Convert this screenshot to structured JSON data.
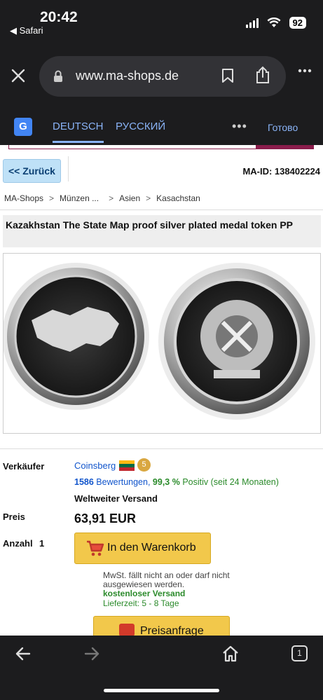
{
  "status": {
    "time": "20:42",
    "back_app": "◀ Safari",
    "battery": "92"
  },
  "browser": {
    "url": "www.ma-shops.de"
  },
  "translate": {
    "tabs": [
      "DEUTSCH",
      "РУССКИЙ"
    ],
    "done": "Готово",
    "more": "•••"
  },
  "page": {
    "back_label": "<< Zurück",
    "ma_id": "MA-ID: 138402224",
    "breadcrumb": [
      "MA-Shops",
      "Münzen ...",
      "Asien",
      "Kasachstan"
    ],
    "title": "Kazakhstan The State Map proof silver plated medal token PP",
    "seller_label": "Verkäufer",
    "seller_name": "Coinsberg",
    "seller_badge": "5",
    "ratings_count": "1586",
    "ratings_word": "Bewertungen,",
    "positive_pct": "99,3 %",
    "positive_text": "Positiv (seit 24 Monaten)",
    "shipping": "Weltweiter Versand",
    "price_label": "Preis",
    "price": "63,91 EUR",
    "qty_label": "Anzahl",
    "qty": "1",
    "cart_button": "In den Warenkorb",
    "vat_note": "MwSt. fällt nicht an oder darf nicht ausgewiesen werden.",
    "free_shipping": "kostenloser Versand",
    "delivery": "Lieferzeit: 5 - 8 Tage",
    "price_request": "Preisanfrage"
  },
  "toolbar": {
    "tabs_count": "1"
  },
  "colors": {
    "chrome_bg": "#1c1c1e",
    "link_blue": "#1155cc",
    "green": "#2a8a2a",
    "button_yellow": "#f2c84b"
  }
}
